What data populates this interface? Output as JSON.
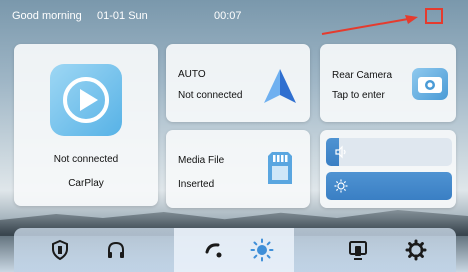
{
  "status_bar": {
    "greeting": "Good morning",
    "date": "01-01  Sun",
    "time": "00:07"
  },
  "cards": {
    "carplay": {
      "status": "Not connected",
      "name": "CarPlay"
    },
    "auto": {
      "name": "AUTO",
      "status": "Not connected"
    },
    "rear_camera": {
      "name": "Rear Camera",
      "action": "Tap to enter"
    },
    "media_file": {
      "name": "Media File",
      "status": "Inserted"
    }
  },
  "sliders": {
    "volume": {
      "icon": "volume-icon",
      "level": 0.1
    },
    "brightness": {
      "icon": "brightness-icon",
      "level": 1.0
    }
  },
  "dock": {
    "items": [
      "shield-icon",
      "headphones-icon",
      "arc-icon",
      "sun-icon",
      "screen-mirror-icon",
      "settings-gear-icon"
    ]
  },
  "colors": {
    "accent": "#3a7fc4",
    "highlight": "#e53b2e"
  }
}
